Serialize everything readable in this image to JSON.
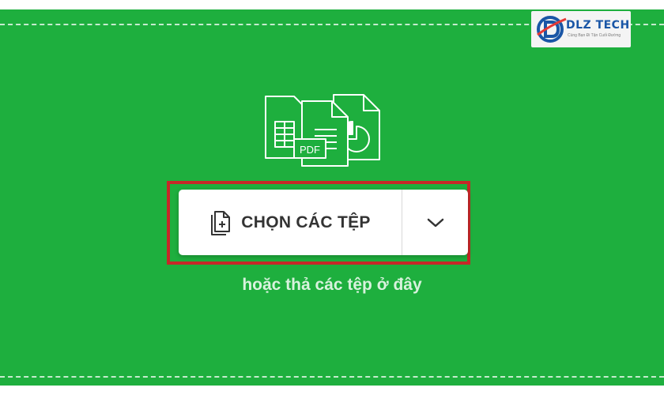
{
  "logo": {
    "icon": "dlz-tech-logo",
    "text": "DLZ TECH",
    "tagline": "Cùng Bạn Đi Tận Cuối Đường",
    "colors": {
      "primary": "#1a56a6",
      "accent": "#e53935"
    }
  },
  "illustration": {
    "icon": "documents-stack-icon",
    "pdf_label": "PDF"
  },
  "upload": {
    "choose_button_label": "CHỌN CÁC TỆP",
    "choose_button_icon": "file-add-icon",
    "dropdown_icon": "chevron-down-icon",
    "drop_hint": "hoặc thả các tệp ở đây"
  },
  "colors": {
    "panel_background": "#1eaf3e",
    "highlight_border": "#c62828",
    "button_background": "#ffffff",
    "button_text": "#333333"
  }
}
